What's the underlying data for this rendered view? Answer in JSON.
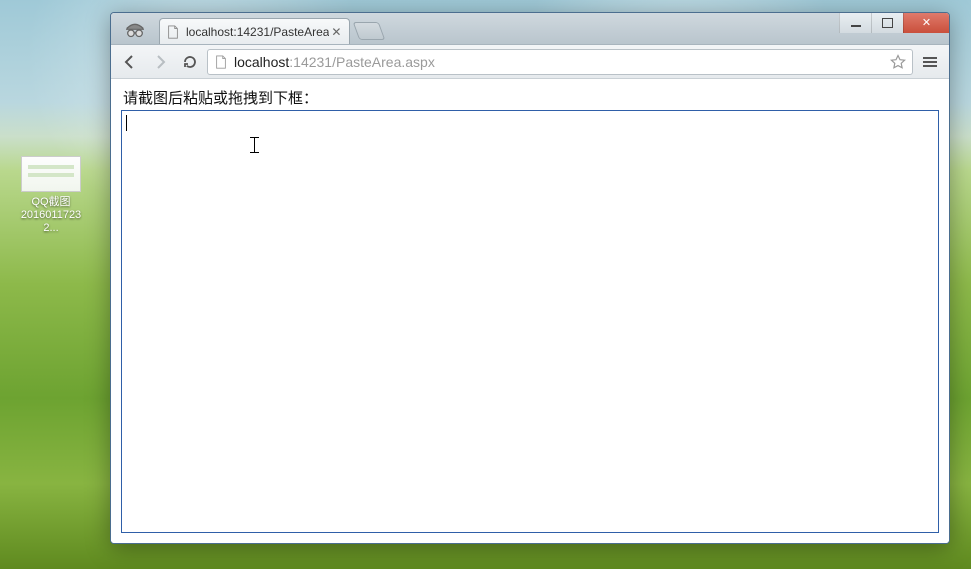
{
  "desktop": {
    "icon": {
      "label_line1": "QQ截图",
      "label_line2": "20160117232..."
    }
  },
  "browser": {
    "tab": {
      "title": "localhost:14231/PasteArea"
    },
    "address": {
      "host": "localhost",
      "port": ":14231",
      "path": "/PasteArea.aspx"
    },
    "page": {
      "label": "请截图后粘贴或拖拽到下框："
    }
  }
}
